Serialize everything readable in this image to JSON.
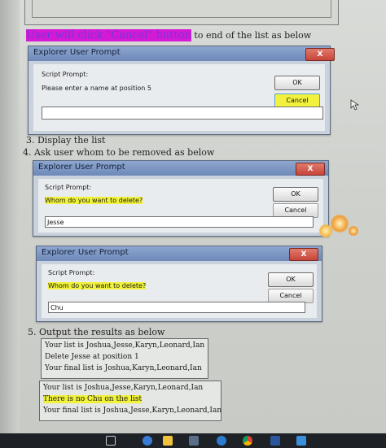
{
  "step_intro": {
    "highlighted": "User will click \"Cancel\" button",
    "rest": " to end of the list as below"
  },
  "dialog1": {
    "title": "Explorer User Prompt",
    "close": "X",
    "script_prompt": "Script Prompt:",
    "message": "Please enter a name at position 5",
    "ok": "OK",
    "cancel": "Cancel",
    "input_value": ""
  },
  "step3": "3. Display the list",
  "step4": "4. Ask user whom to be removed as below",
  "dialog2": {
    "title": "Explorer User Prompt",
    "close": "X",
    "script_prompt": "Script Prompt:",
    "message": "Whom do you want to delete?",
    "ok": "OK",
    "cancel": "Cancel",
    "input_value": "Jesse"
  },
  "dialog3": {
    "title": "Explorer User Prompt",
    "close": "X",
    "script_prompt": "Script Prompt:",
    "message": "Whom do you want to delete?",
    "ok": "OK",
    "cancel": "Cancel",
    "input_value": "Chu"
  },
  "step5": "5. Output the results as below",
  "output1": [
    "Your list is Joshua,Jesse,Karyn,Leonard,Ian",
    "Delete Jesse at position 1",
    "Your final list is Joshua,Karyn,Leonard,Ian"
  ],
  "output2": [
    "Your list is Joshua,Jesse,Karyn,Leonard,Ian",
    "There is no Chu on the list",
    "Your final list is Joshua,Jesse,Karyn,Leonard,Ian"
  ],
  "colors": {
    "magenta_highlight": "#d51ad6",
    "yellow_highlight": "#f1f23a",
    "title_bar": "#7b95c3",
    "close_button": "#c8453a"
  },
  "taskbar_icons": [
    "task-view-icon",
    "search-icon",
    "file-explorer-icon",
    "store-icon",
    "edge-icon",
    "chrome-icon",
    "word-icon",
    "windows-icon"
  ]
}
